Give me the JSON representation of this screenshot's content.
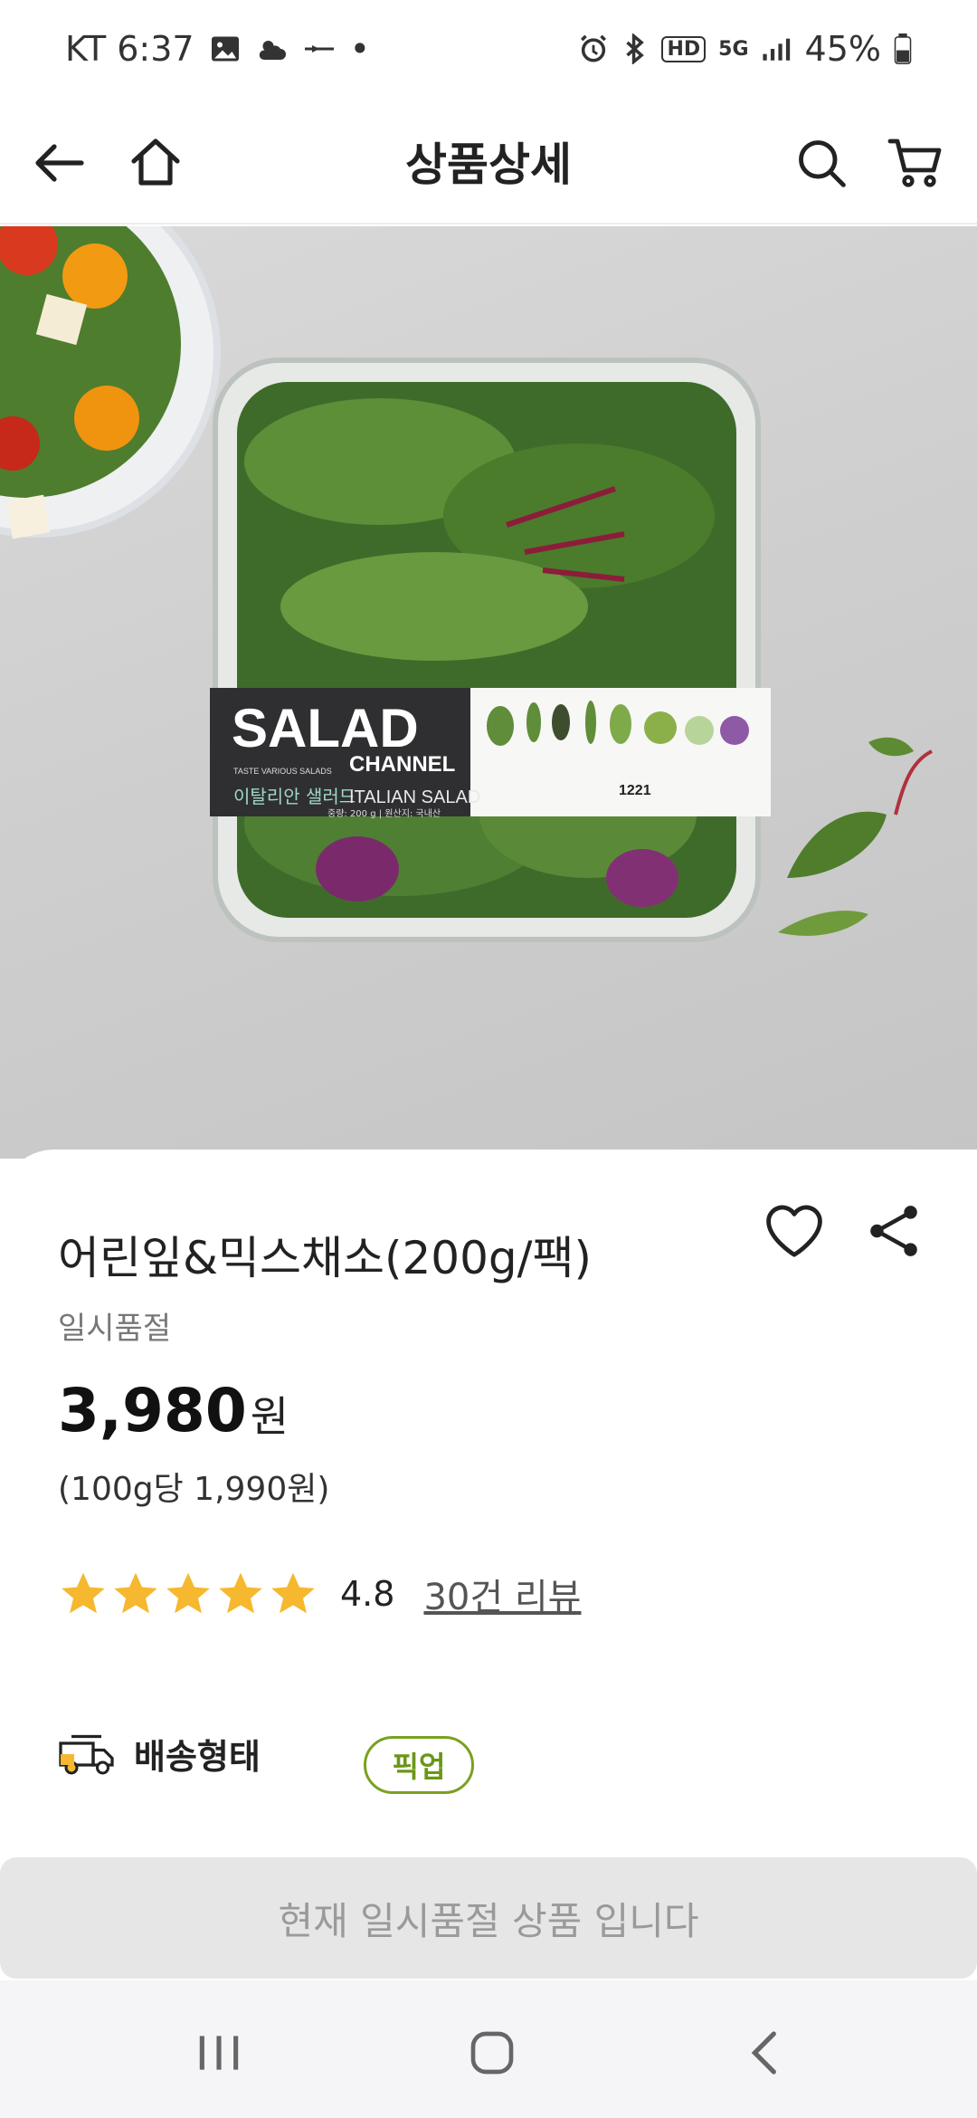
{
  "status_bar": {
    "carrier_time": "KT 6:37",
    "dot": "•",
    "hd_label": "HD",
    "net_label": "5G",
    "battery": "45%",
    "icons": [
      "gallery-icon",
      "weather-icon",
      "app-icon",
      "alarm-icon",
      "bluetooth-icon",
      "signal-icon",
      "battery-icon"
    ]
  },
  "header": {
    "title": "상품상세",
    "icons": [
      "back-arrow-icon",
      "home-icon",
      "search-icon",
      "cart-icon"
    ]
  },
  "product": {
    "name": "어린잎&믹스채소(200g/팩)",
    "status": "일시품절",
    "price": "3,980",
    "price_unit": "원",
    "unit_price": "(100g당 1,990원)",
    "rating": "4.8",
    "rating_fraction": 0.96,
    "stars": 5,
    "review_link": "30건 리뷰",
    "image": {
      "brand_main": "SALAD",
      "brand_sub": "CHANNEL",
      "tagline": "TASTE VARIOUS SALADS",
      "name_ko": "이탈리안 샐러드",
      "name_en": "ITALIAN SALAD",
      "weight_origin": "중량: 200 g | 원산지: 국내산",
      "code": "1221"
    }
  },
  "delivery": {
    "label": "배송형태",
    "badge": "픽업"
  },
  "soldout_message": "현재 일시품절 상품 입니다",
  "colors": {
    "accent_green": "#6a9716",
    "star": "#f5b82e",
    "soldout_bg": "#e6e6e6"
  },
  "nav": {
    "icons": [
      "recent-apps-icon",
      "home-circle-icon",
      "back-chevron-icon"
    ]
  }
}
